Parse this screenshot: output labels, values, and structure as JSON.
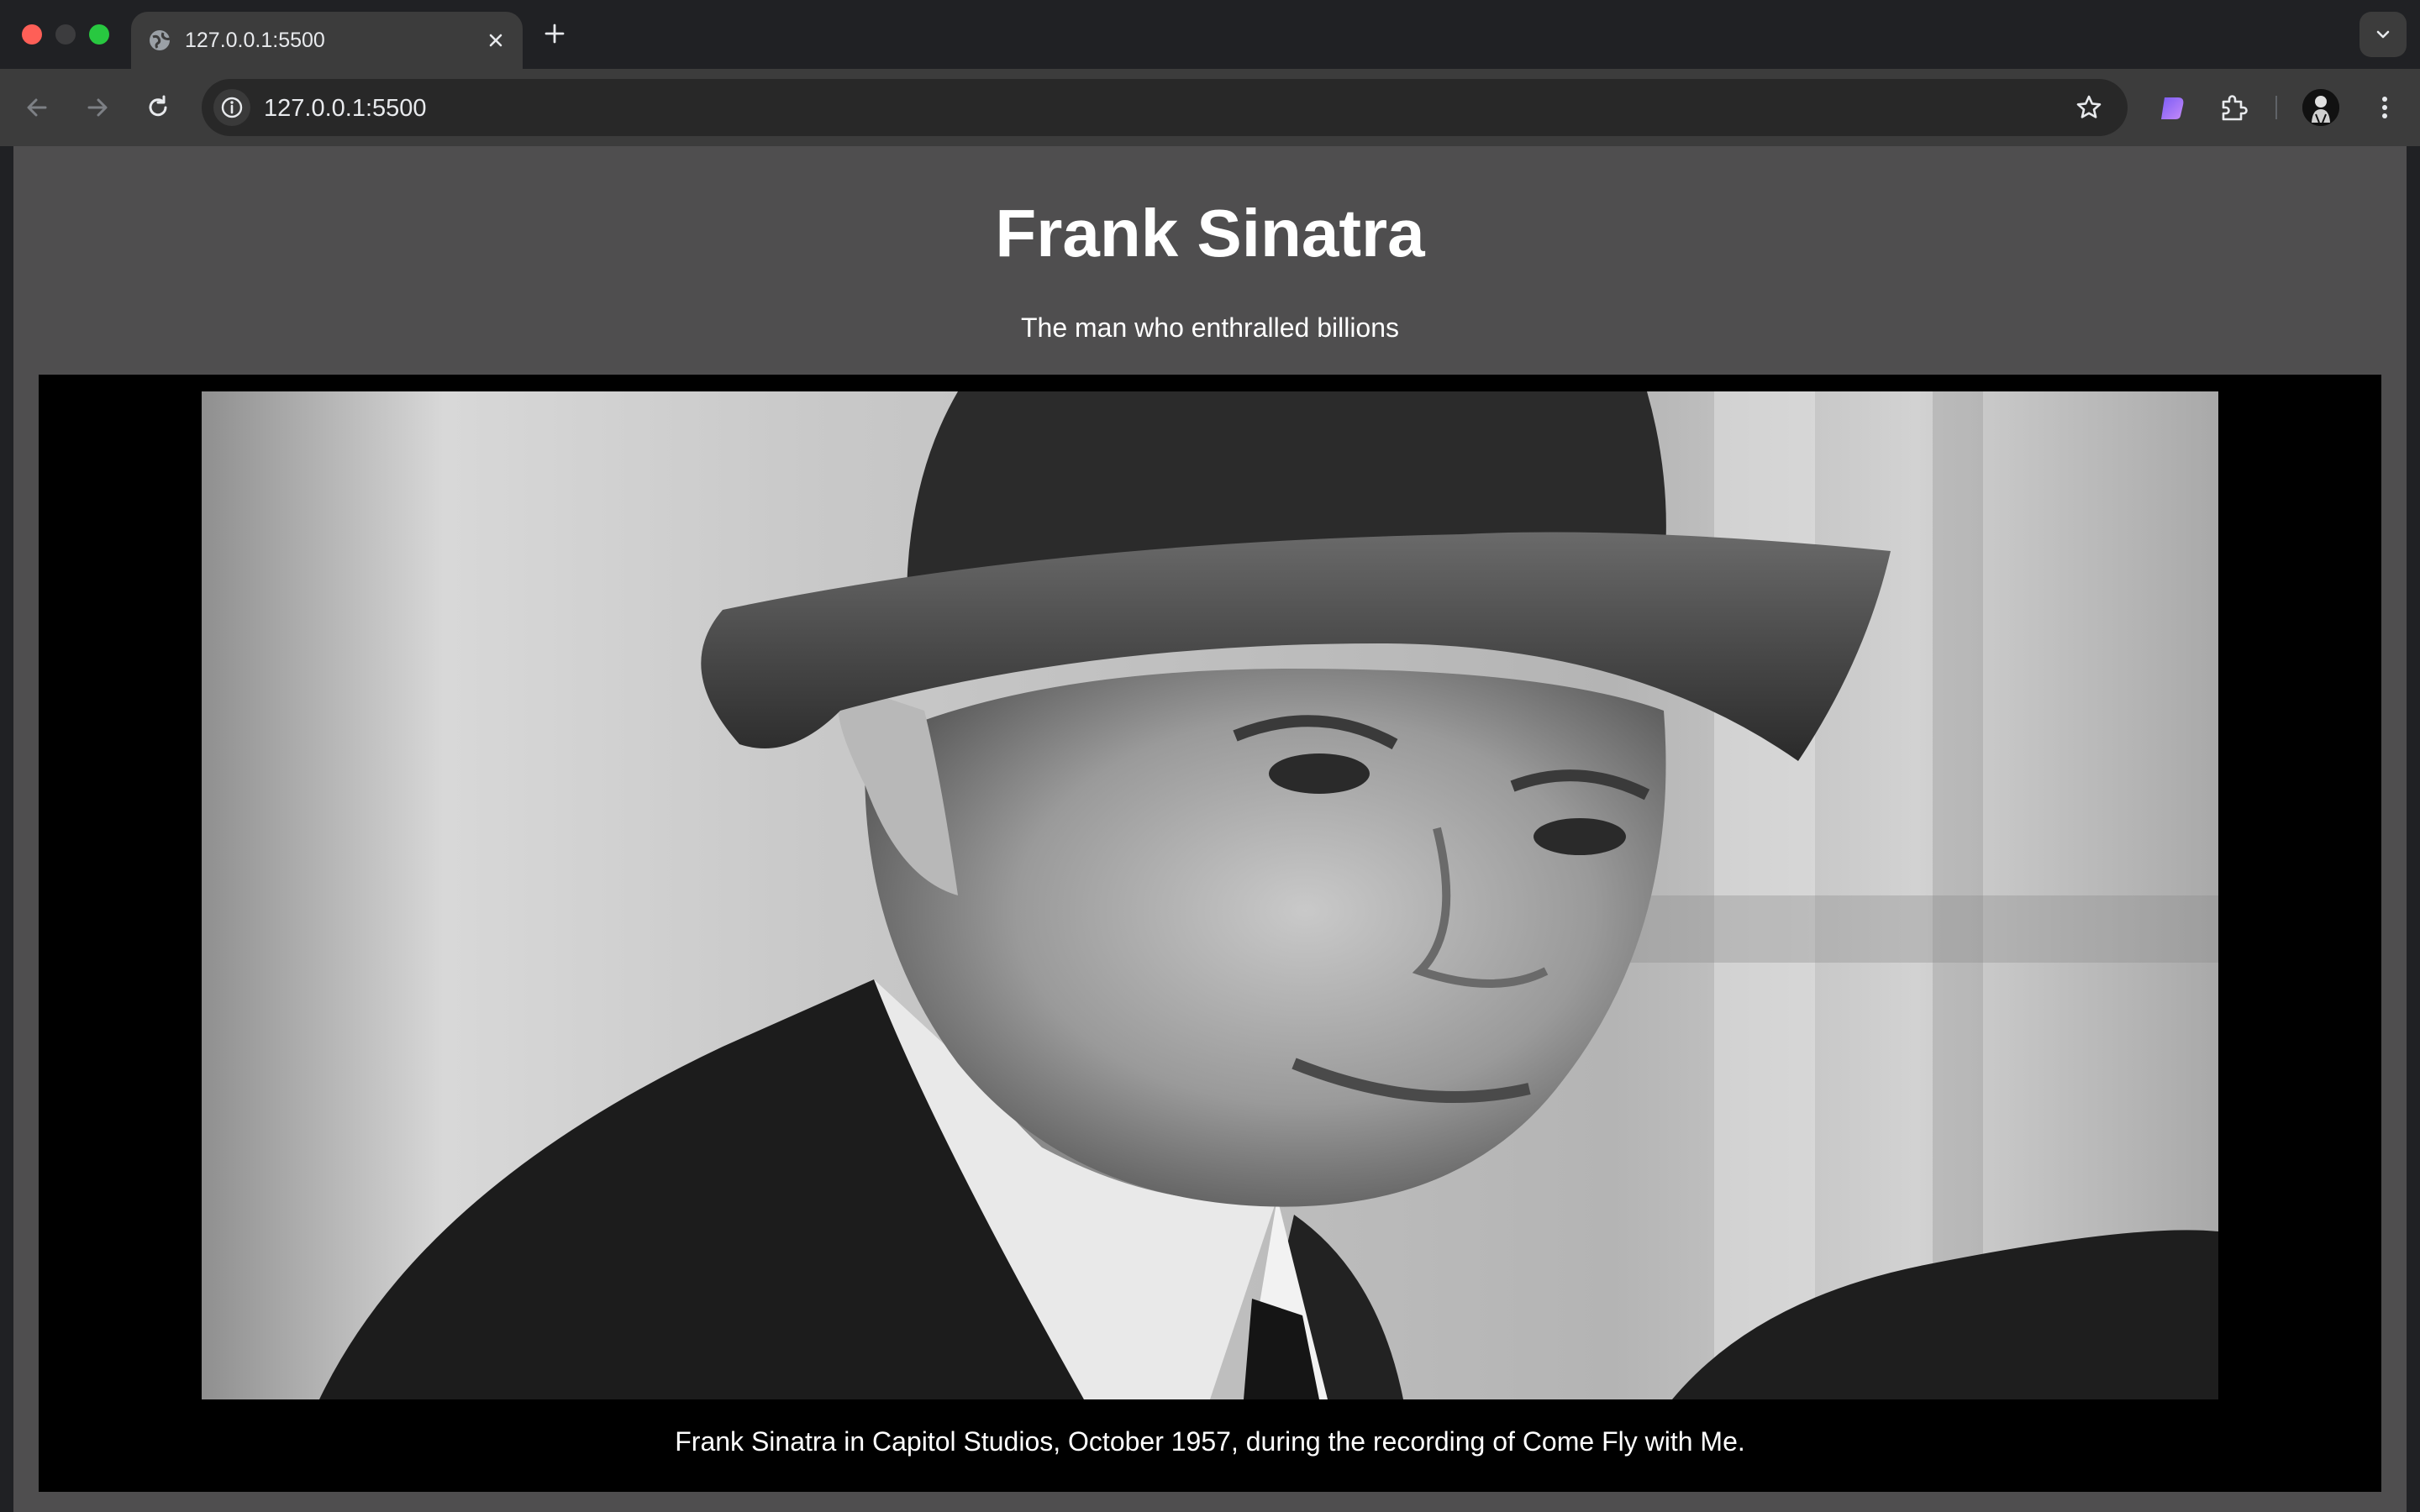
{
  "browser": {
    "tab_title": "127.0.0.1:5500",
    "url": "127.0.0.1:5500"
  },
  "page": {
    "title": "Frank Sinatra",
    "subtitle": "The man who enthralled billions",
    "caption": "Frank Sinatra in Capitol Studios, October 1957, during the recording of Come Fly with Me."
  },
  "colors": {
    "page_background": "#4f4e4f",
    "figure_background": "#000000",
    "text": "#ffffff"
  }
}
